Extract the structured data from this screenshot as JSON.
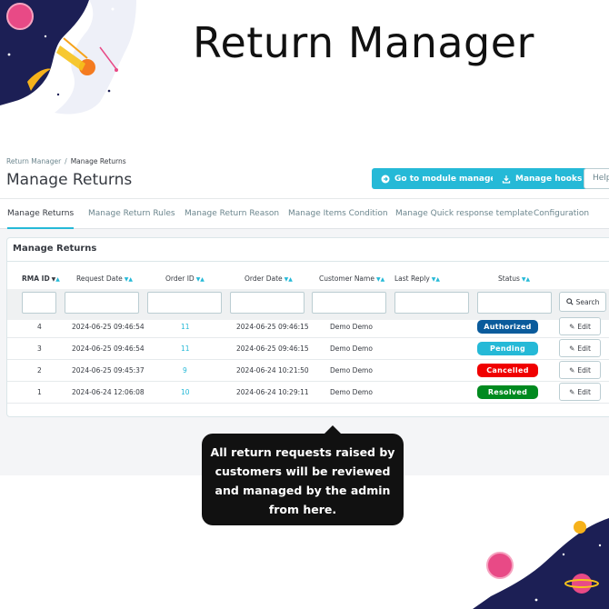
{
  "hero_title": "Return Manager",
  "breadcrumb": {
    "root": "Return Manager",
    "separator": "/",
    "current": "Manage Returns"
  },
  "page_title": "Manage Returns",
  "toolbar": {
    "module_manager_label": "Go to module manager",
    "module_manager_icon": "circle-arrow-icon",
    "hooks_label": "Manage hooks",
    "hooks_icon": "download-icon",
    "help_label": "Help"
  },
  "tabs": [
    {
      "label": "Manage Returns",
      "active": true
    },
    {
      "label": "Manage Return Rules",
      "active": false
    },
    {
      "label": "Manage Return Reason",
      "active": false
    },
    {
      "label": "Manage Items Condition",
      "active": false
    },
    {
      "label": "Manage Quick response template",
      "active": false
    },
    {
      "label": "Configuration",
      "active": false
    }
  ],
  "card": {
    "title": "Manage Returns",
    "columns": [
      "RMA ID",
      "Request Date",
      "Order ID",
      "Order Date",
      "Customer Name",
      "Last Reply",
      "Status"
    ],
    "search_label": "Search",
    "edit_label": "Edit",
    "rows": [
      {
        "rma_id": "4",
        "request_date": "2024-06-25 09:46:54",
        "order_id": "11",
        "order_date": "2024-06-25 09:46:15",
        "customer": "Demo Demo",
        "last_reply": "",
        "status": "Authorized",
        "status_color": "#0a5b9c"
      },
      {
        "rma_id": "3",
        "request_date": "2024-06-25 09:46:54",
        "order_id": "11",
        "order_date": "2024-06-25 09:46:15",
        "customer": "Demo Demo",
        "last_reply": "",
        "status": "Pending",
        "status_color": "#25b9d7"
      },
      {
        "rma_id": "2",
        "request_date": "2024-06-25 09:45:37",
        "order_id": "9",
        "order_date": "2024-06-24 10:21:50",
        "customer": "Demo Demo",
        "last_reply": "",
        "status": "Cancelled",
        "status_color": "#f00000"
      },
      {
        "rma_id": "1",
        "request_date": "2024-06-24 12:06:08",
        "order_id": "10",
        "order_date": "2024-06-24 10:29:11",
        "customer": "Demo Demo",
        "last_reply": "",
        "status": "Resolved",
        "status_color": "#008a1f"
      }
    ]
  },
  "callout_text": "All return requests raised by customers will be reviewed and managed by the admin from here.",
  "colors": {
    "accent": "#25b9d7",
    "callout_bg": "#111111"
  }
}
